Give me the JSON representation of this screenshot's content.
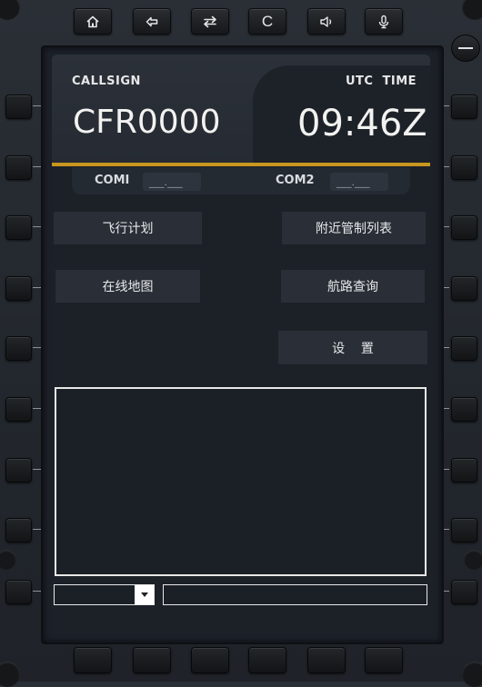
{
  "top_buttons": [
    {
      "icon": "home-icon"
    },
    {
      "icon": "back-arrow-icon"
    },
    {
      "icon": "swap-icon"
    },
    {
      "icon": "clear-icon",
      "label": "C"
    },
    {
      "icon": "speaker-icon"
    },
    {
      "icon": "microphone-icon"
    }
  ],
  "header": {
    "callsign_label": "CALLSIGN",
    "callsign_value": "CFR0000",
    "utc_label": "UTC  TIME",
    "utc_value": "09:46Z"
  },
  "com": {
    "com1_label": "COMI",
    "com1_value": "___.___",
    "com2_label": "COM2",
    "com2_value": "___.___"
  },
  "menu": {
    "flight_plan": "飞行计划",
    "nearby_atc": "附近管制列表",
    "online_map": "在线地图",
    "route_query": "航路查询",
    "settings": "设    置"
  },
  "output": {
    "text": ""
  },
  "input": {
    "select_value": "",
    "text_value": ""
  },
  "colors": {
    "accent": "#c9961f",
    "text": "#f2f2f0",
    "screen_bg": "#1c2128"
  }
}
